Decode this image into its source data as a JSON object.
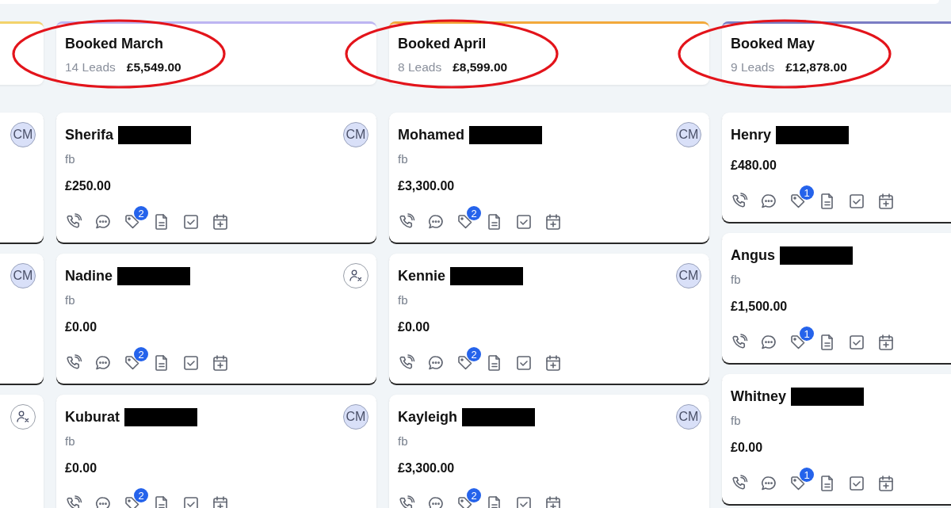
{
  "columns": [
    {
      "color": "#f3d36b",
      "highlighted": false,
      "cards": [
        {
          "assignee": {
            "kind": "initials",
            "text": "CM"
          }
        },
        {
          "assignee": {
            "kind": "initials",
            "text": "CM"
          }
        },
        {
          "assignee": {
            "kind": "unassigned"
          }
        }
      ]
    },
    {
      "title": "Booked March",
      "leads": "14 Leads",
      "total": "£5,549.00",
      "color": "#bdb5f2",
      "highlighted": true,
      "cards": [
        {
          "name": "Sherifa",
          "redacted": true,
          "source": "fb",
          "amount": "£250.00",
          "assignee": {
            "kind": "initials",
            "text": "CM"
          },
          "tag_count": "2"
        },
        {
          "name": "Nadine",
          "redacted": true,
          "source": "fb",
          "amount": "£0.00",
          "assignee": {
            "kind": "unassigned"
          },
          "tag_count": "2"
        },
        {
          "name": "Kuburat",
          "redacted": true,
          "source": "fb",
          "amount": "£0.00",
          "assignee": {
            "kind": "initials",
            "text": "CM"
          },
          "tag_count": "2"
        }
      ]
    },
    {
      "title": "Booked April",
      "leads": "8 Leads",
      "total": "£8,599.00",
      "color": "#f2a93b",
      "highlighted": true,
      "cards": [
        {
          "name": "Mohamed",
          "redacted": true,
          "source": "fb",
          "amount": "£3,300.00",
          "assignee": {
            "kind": "initials",
            "text": "CM"
          },
          "tag_count": "2"
        },
        {
          "name": "Kennie",
          "redacted": true,
          "source": "fb",
          "amount": "£0.00",
          "assignee": {
            "kind": "initials",
            "text": "CM"
          },
          "tag_count": "2"
        },
        {
          "name": "Kayleigh",
          "redacted": true,
          "source": "fb",
          "amount": "£3,300.00",
          "assignee": {
            "kind": "initials",
            "text": "CM"
          },
          "tag_count": "2"
        }
      ]
    },
    {
      "title": "Booked May",
      "leads": "9 Leads",
      "total": "£12,878.00",
      "color": "#7b7dc4",
      "highlighted": true,
      "cards": [
        {
          "name": "Henry",
          "redacted": true,
          "amount": "£480.00",
          "tag_count": "1"
        },
        {
          "name": "Angus",
          "redacted": true,
          "source": "fb",
          "amount": "£1,500.00",
          "tag_count": "1"
        },
        {
          "name": "Whitney",
          "redacted": true,
          "source": "fb",
          "amount": "£0.00",
          "tag_count": "1"
        }
      ]
    }
  ]
}
